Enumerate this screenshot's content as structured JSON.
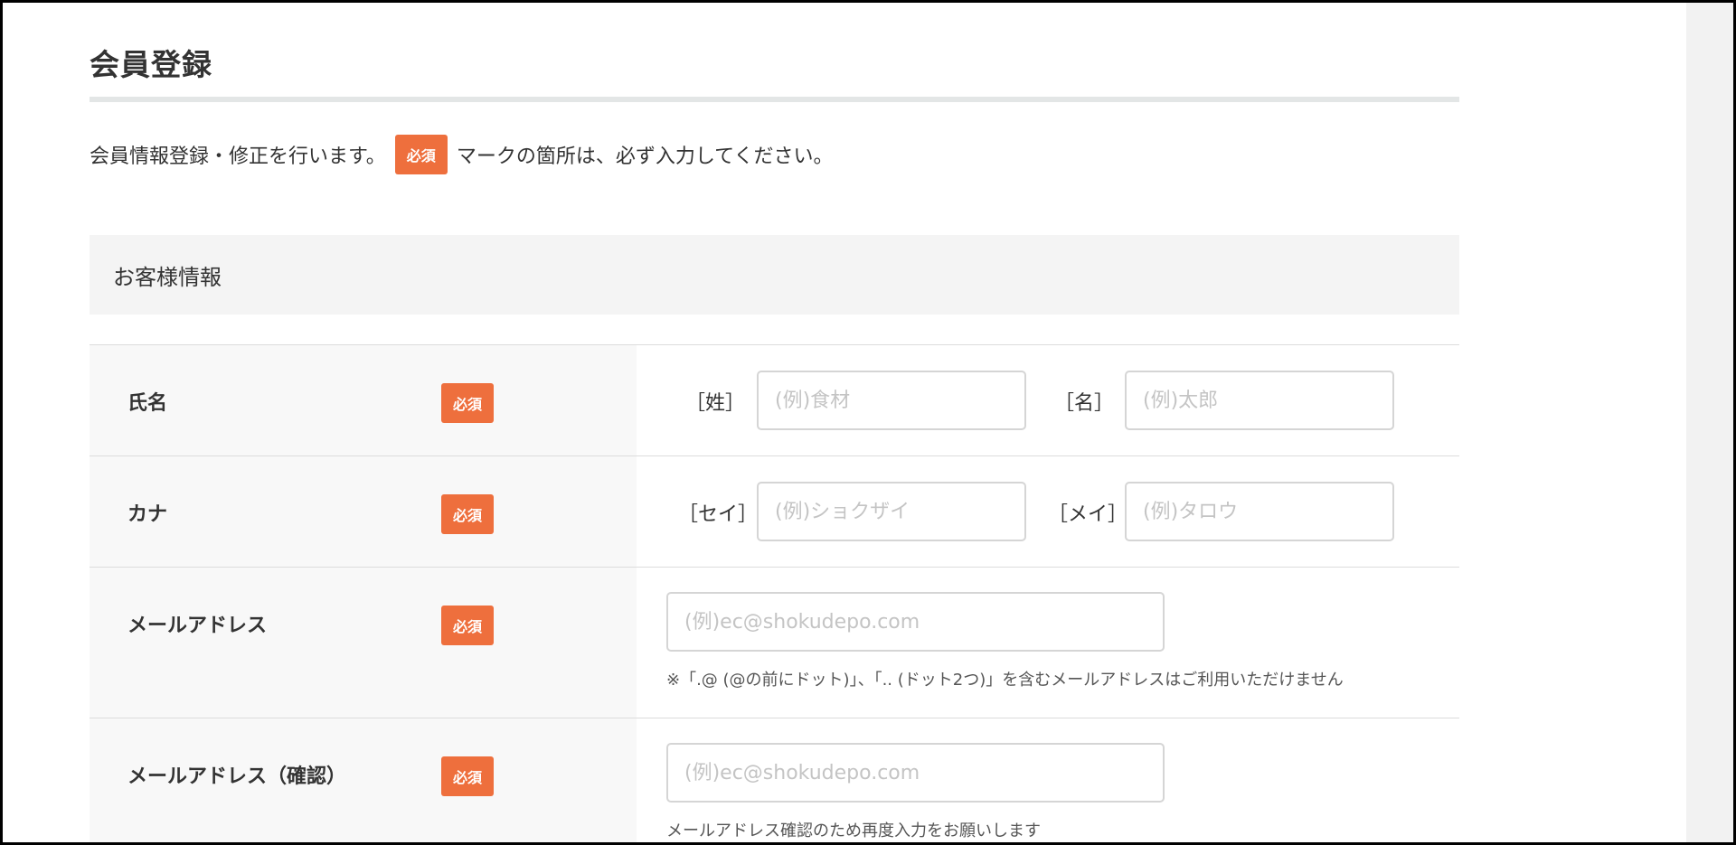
{
  "page": {
    "title": "会員登録",
    "intro_before": "会員情報登録・修正を行います。",
    "intro_badge": "必須",
    "intro_after": "マークの箇所は、必ず入力してください。"
  },
  "section": {
    "title": "お客様情報"
  },
  "rows": {
    "name": {
      "label": "氏名",
      "badge": "必須",
      "last_label": "［姓］",
      "last_placeholder": "(例)食材",
      "first_label": "［名］",
      "first_placeholder": "(例)太郎"
    },
    "kana": {
      "label": "カナ",
      "badge": "必須",
      "last_label": "［セイ］",
      "last_placeholder": "(例)ショクザイ",
      "first_label": "［メイ］",
      "first_placeholder": "(例)タロウ"
    },
    "email": {
      "label": "メールアドレス",
      "badge": "必須",
      "placeholder": "(例)ec@shokudepo.com",
      "note": "※「.@ (@の前にドット)」、「.. (ドット2つ)」を含むメールアドレスはご利用いただけません"
    },
    "email_confirm": {
      "label": "メールアドレス（確認）",
      "badge": "必須",
      "placeholder": "(例)ec@shokudepo.com",
      "note": "メールアドレス確認のため再度入力をお願いします"
    }
  },
  "colors": {
    "required_badge": "#ee6f3d",
    "label_bg": "#f8f8f8",
    "section_bg": "#f4f4f4"
  }
}
